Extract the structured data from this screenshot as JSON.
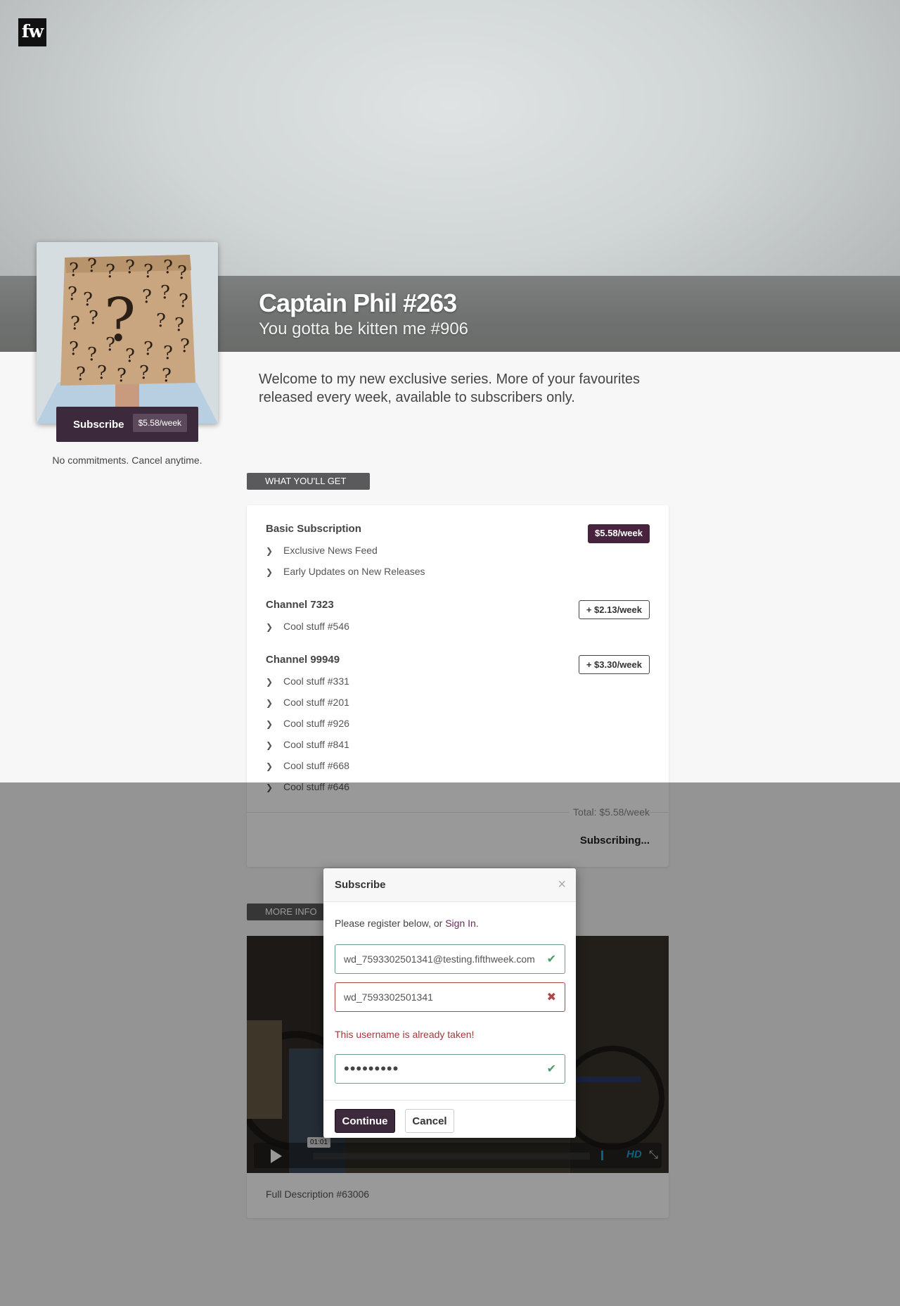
{
  "header": {
    "logo": "fw",
    "title": "Captain Phil #263",
    "subtitle": "You gotta be kitten me #906"
  },
  "sidebar": {
    "subscribe_label": "Subscribe",
    "subscribe_price": "$5.58/week",
    "no_commitments": "No commitments. Cancel anytime."
  },
  "intro": "Welcome to my new exclusive series. More of your favourites released every week, available to subscribers only.",
  "what_youll_get": {
    "tag": "WHAT YOU'LL GET",
    "tiers": [
      {
        "name": "Basic Subscription",
        "price": "$5.58/week",
        "features": [
          "Exclusive News Feed",
          "Early Updates on New Releases"
        ]
      },
      {
        "name": "Channel 7323",
        "price": "+ $2.13/week",
        "features": [
          "Cool stuff #546"
        ]
      },
      {
        "name": "Channel 99949",
        "price": "+ $3.30/week",
        "features": [
          "Cool stuff #331",
          "Cool stuff #201",
          "Cool stuff #926",
          "Cool stuff #841",
          "Cool stuff #668",
          "Cool stuff #646"
        ]
      }
    ],
    "total": "Total:  $5.58/week",
    "status": "Subscribing..."
  },
  "more_info": {
    "tag": "MORE INFO",
    "video_time": "01:01",
    "video_quality": "HD",
    "description": "Full Description #63006"
  },
  "modal": {
    "title": "Subscribe",
    "close": "×",
    "note_prefix": "Please register below, or ",
    "sign_in": "Sign In",
    "note_suffix": ".",
    "email_value": "wd_7593302501341@testing.fifthweek.com",
    "username_value": "wd_7593302501341",
    "username_error": "This username is already taken!",
    "password_value": "•••••••••",
    "continue_label": "Continue",
    "cancel_label": "Cancel"
  },
  "icons": {
    "valid": "check-icon",
    "invalid": "cross-icon",
    "feature": "chevron-right-icon"
  },
  "colors": {
    "brand": "#3c2a3c",
    "price_badge": "#48233e",
    "valid": "#4a9a6a",
    "invalid": "#b04545"
  }
}
